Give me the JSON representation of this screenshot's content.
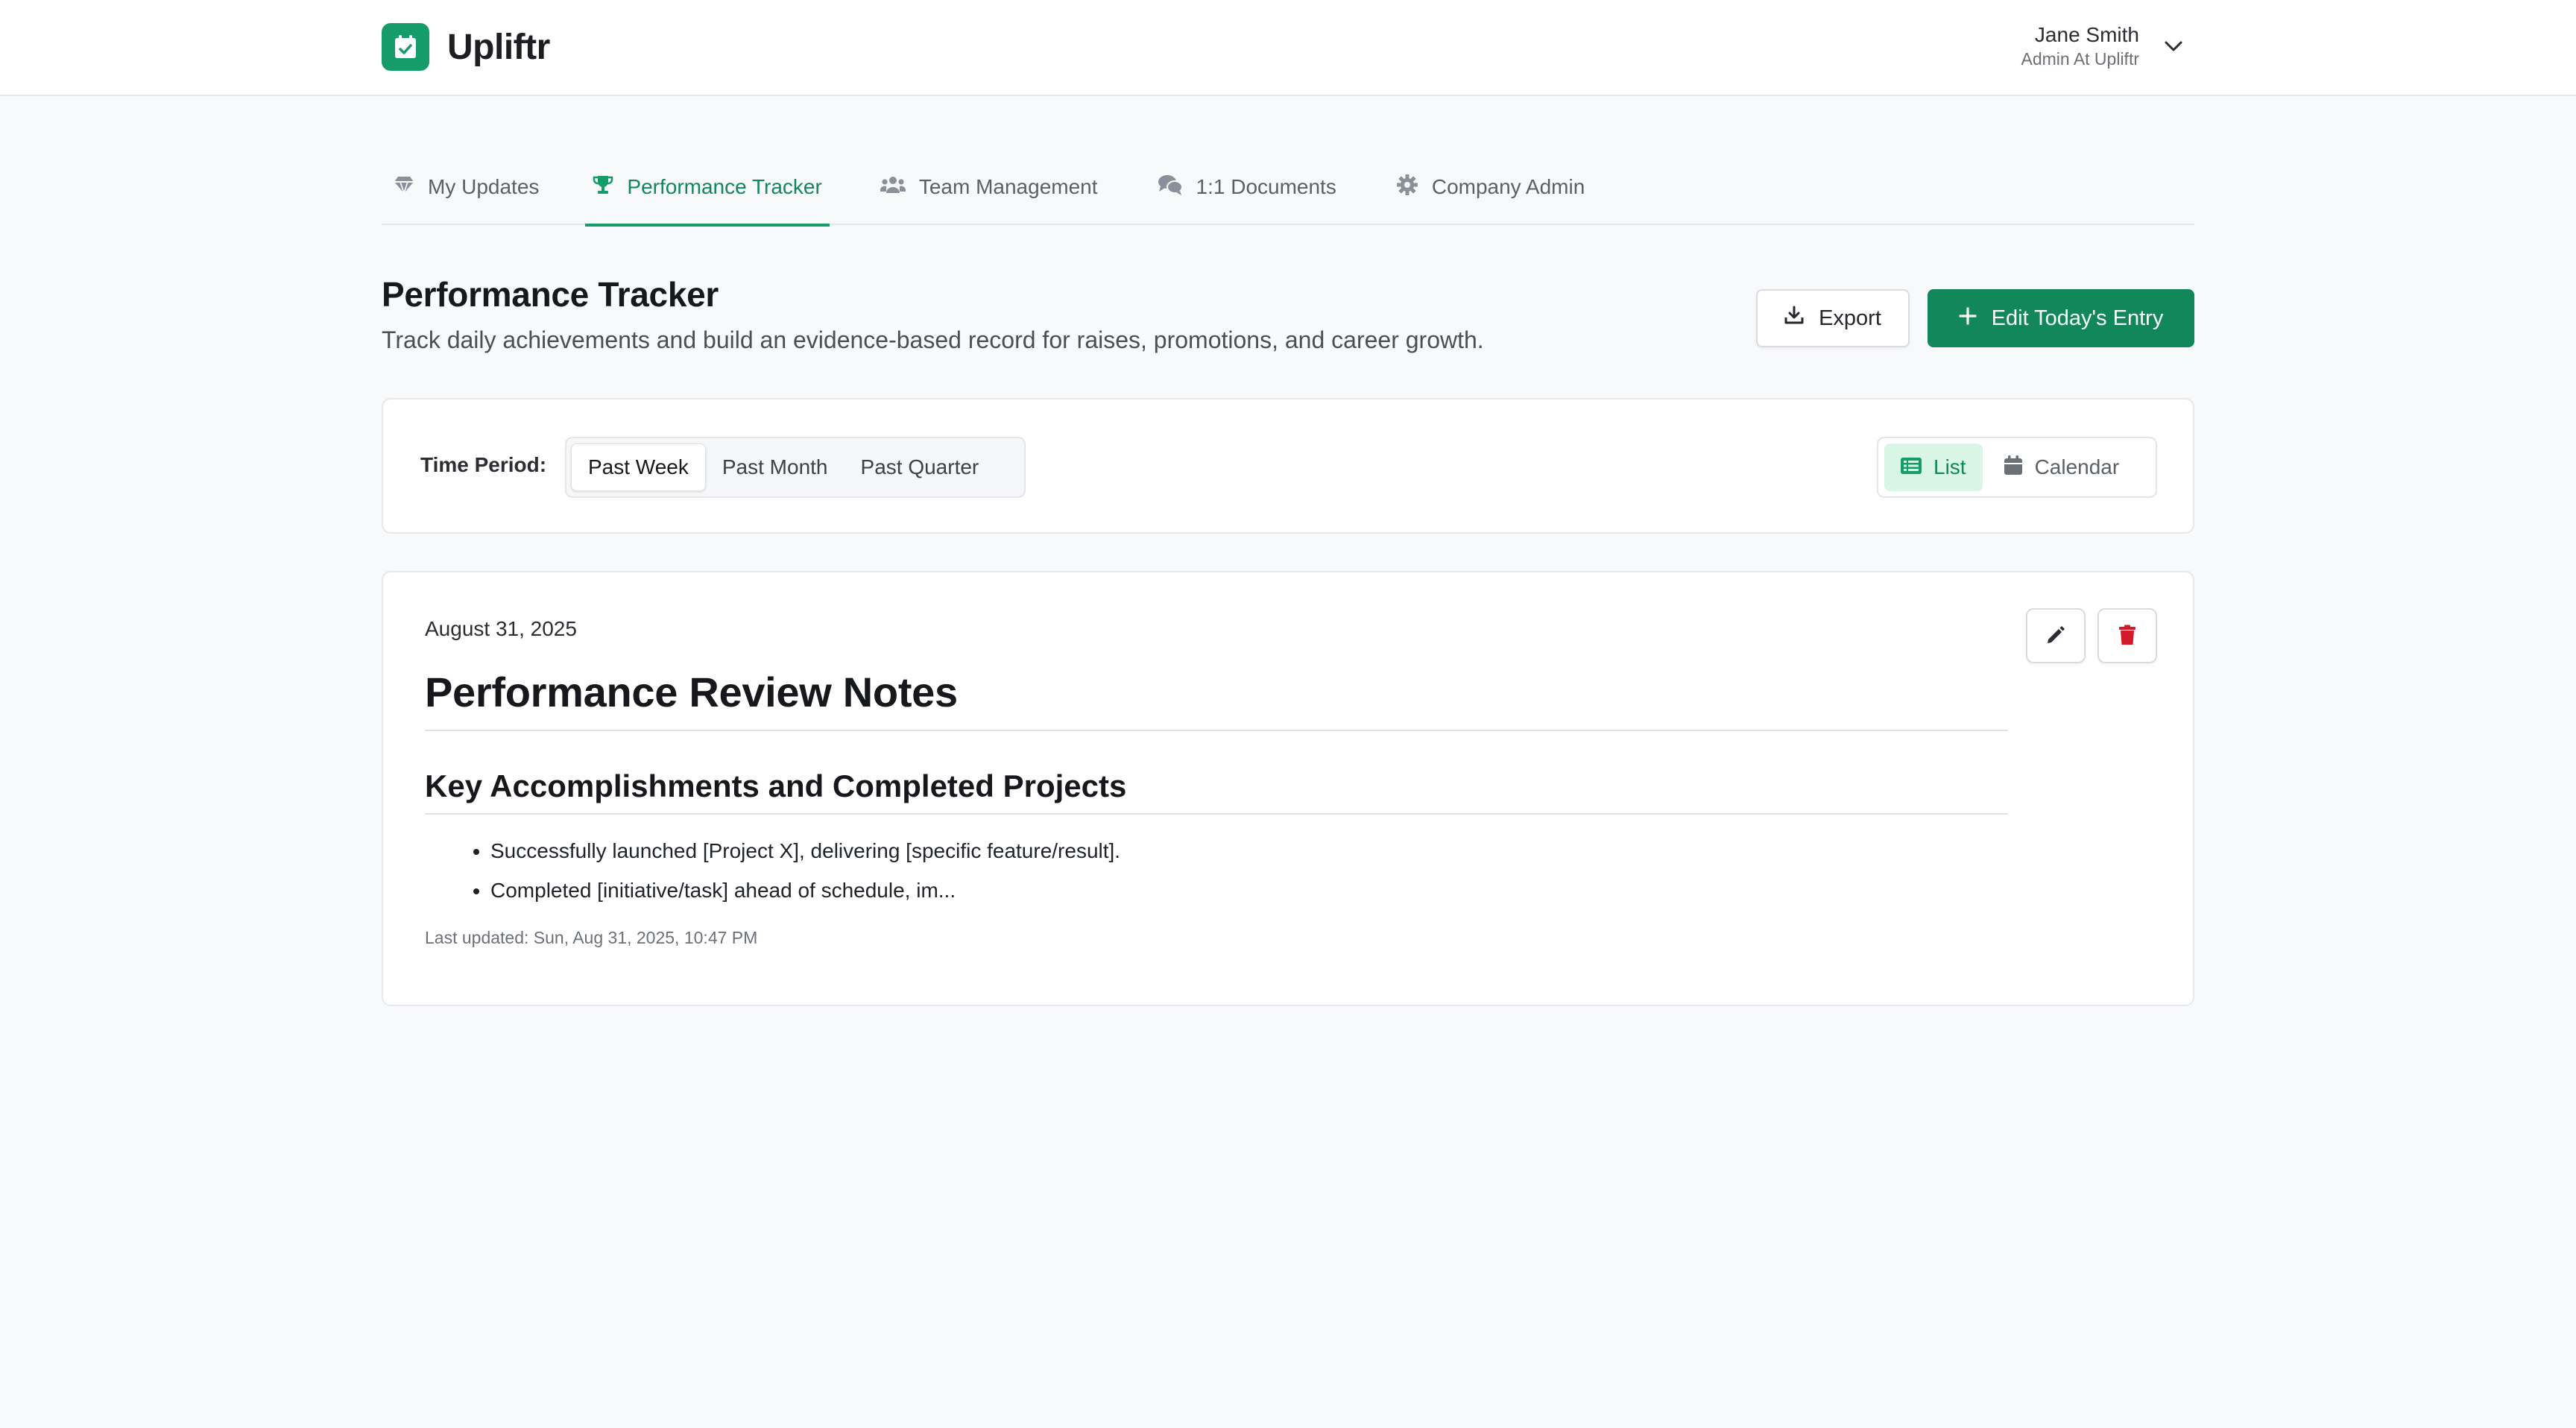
{
  "app": {
    "name": "Upliftr",
    "brand_color": "#169b6a",
    "logo_icon": "calendar-check-icon"
  },
  "user": {
    "name": "Jane Smith",
    "role": "Admin At Upliftr",
    "menu_icon": "chevron-down-icon"
  },
  "nav": {
    "tabs": [
      {
        "label": "My Updates",
        "icon": "gem-icon",
        "active": false
      },
      {
        "label": "Performance Tracker",
        "icon": "trophy-icon",
        "active": true
      },
      {
        "label": "Team Management",
        "icon": "users-icon",
        "active": false
      },
      {
        "label": "1:1 Documents",
        "icon": "comments-icon",
        "active": false
      },
      {
        "label": "Company Admin",
        "icon": "gear-icon",
        "active": false
      }
    ]
  },
  "page": {
    "title": "Performance Tracker",
    "subtitle": "Track daily achievements and build an evidence-based record for raises, promotions, and career growth.",
    "export_label": "Export",
    "edit_label": "Edit Today's Entry"
  },
  "filters": {
    "time_period_label": "Time Period:",
    "periods": [
      "Past Week",
      "Past Month",
      "Past Quarter"
    ],
    "selected_period": "Past Week",
    "views": [
      "List",
      "Calendar"
    ],
    "selected_view": "List"
  },
  "entry": {
    "date": "August 31, 2025",
    "heading": "Performance Review Notes",
    "subheading": "Key Accomplishments and Completed Projects",
    "items": [
      "Successfully launched [Project X], delivering [specific feature/result].",
      "Completed [initiative/task] ahead of schedule, im..."
    ],
    "last_updated": "Last updated: Sun, Aug 31, 2025, 10:47 PM"
  }
}
